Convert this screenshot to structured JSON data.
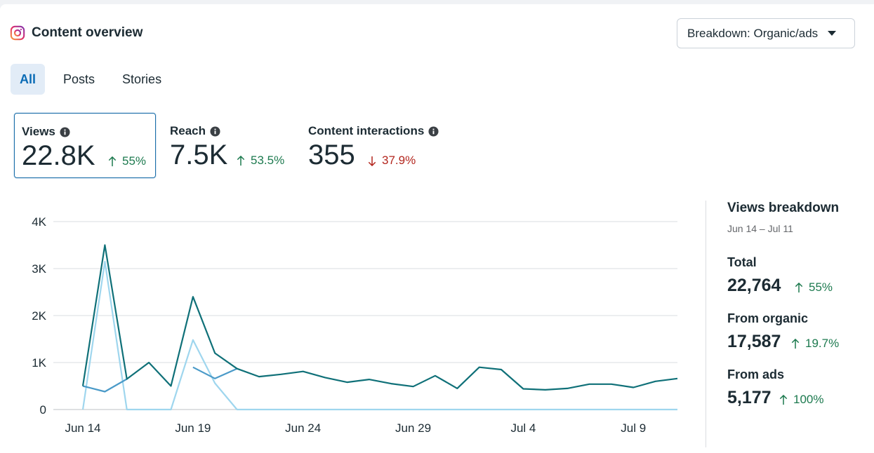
{
  "header": {
    "title": "Content overview",
    "icon": "instagram-icon"
  },
  "breakdown_button": {
    "label": "Breakdown: Organic/ads"
  },
  "tabs": [
    {
      "label": "All",
      "active": true
    },
    {
      "label": "Posts",
      "active": false
    },
    {
      "label": "Stories",
      "active": false
    }
  ],
  "metrics": [
    {
      "label": "Views",
      "value": "22.8K",
      "change": "55%",
      "direction": "up"
    },
    {
      "label": "Reach",
      "value": "7.5K",
      "change": "53.5%",
      "direction": "up"
    },
    {
      "label": "Content interactions",
      "value": "355",
      "change": "37.9%",
      "direction": "down"
    }
  ],
  "breakdown_panel": {
    "title": "Views breakdown",
    "range": "Jun 14 – Jul 11",
    "items": [
      {
        "label": "Total",
        "value": "22,764",
        "change": "55%"
      },
      {
        "label": "From organic",
        "value": "17,587",
        "change": "19.7%"
      },
      {
        "label": "From ads",
        "value": "5,177",
        "change": "100%"
      }
    ]
  },
  "colors": {
    "total": "#0f7078",
    "organic": "#4a9ac8",
    "ads": "#9fd6ee",
    "grid": "#dadde1",
    "up": "#1d7a4f",
    "down": "#b3261e"
  },
  "chart_data": {
    "type": "line",
    "x": [
      "Jun 14",
      "Jun 15",
      "Jun 16",
      "Jun 17",
      "Jun 18",
      "Jun 19",
      "Jun 20",
      "Jun 21",
      "Jun 22",
      "Jun 23",
      "Jun 24",
      "Jun 25",
      "Jun 26",
      "Jun 27",
      "Jun 28",
      "Jun 29",
      "Jun 30",
      "Jul 1",
      "Jul 2",
      "Jul 3",
      "Jul 4",
      "Jul 5",
      "Jul 6",
      "Jul 7",
      "Jul 8",
      "Jul 9",
      "Jul 10",
      "Jul 11"
    ],
    "x_tick_labels": [
      "Jun 14",
      "Jun 19",
      "Jun 24",
      "Jun 29",
      "Jul 4",
      "Jul 9"
    ],
    "y_tick_labels": [
      "0",
      "1K",
      "2K",
      "3K",
      "4K"
    ],
    "ylim": [
      0,
      4000
    ],
    "grid": true,
    "series": [
      {
        "key": "total",
        "values": [
          500,
          3500,
          650,
          1000,
          500,
          2400,
          1200,
          870,
          700,
          750,
          810,
          680,
          580,
          640,
          550,
          490,
          720,
          450,
          900,
          850,
          440,
          420,
          450,
          540,
          540,
          470,
          600,
          660
        ]
      },
      {
        "key": "organic",
        "values": [
          500,
          380,
          650,
          null,
          null,
          900,
          660,
          870,
          null,
          null,
          null,
          null,
          null,
          null,
          null,
          null,
          null,
          null,
          null,
          null,
          null,
          null,
          null,
          null,
          null,
          null,
          null,
          null
        ]
      },
      {
        "key": "ads",
        "values": [
          0,
          3150,
          0,
          0,
          0,
          1480,
          560,
          0,
          0,
          0,
          0,
          0,
          0,
          0,
          0,
          0,
          0,
          0,
          0,
          0,
          0,
          0,
          0,
          0,
          0,
          0,
          0,
          0
        ]
      }
    ]
  }
}
